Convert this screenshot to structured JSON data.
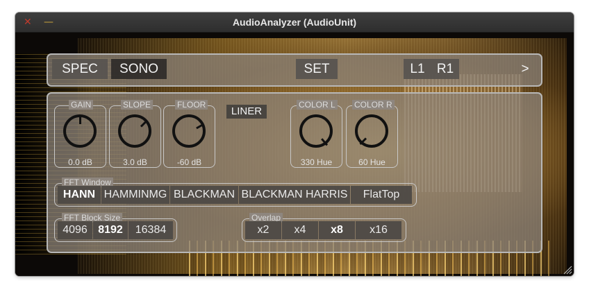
{
  "window": {
    "title": "AudioAnalyzer (AudioUnit)",
    "close_glyph": "✕",
    "minimize_glyph": "—"
  },
  "topbar": {
    "spec_label": "SPEC",
    "sono_label": "SONO",
    "set_label": "SET",
    "left_channel": "L1",
    "right_channel": "R1",
    "next_label": ">"
  },
  "knobs": [
    {
      "label": "GAIN",
      "value": "0.0 dB",
      "angle": 0
    },
    {
      "label": "SLOPE",
      "value": "3.0 dB",
      "angle": 45
    },
    {
      "label": "FLOOR",
      "value": "-60 dB",
      "angle": 60
    },
    {
      "label": "COLOR L",
      "value": "330 Hue",
      "angle": 140
    },
    {
      "label": "COLOR R",
      "value": "60 Hue",
      "angle": 225
    }
  ],
  "liner_label": "LINER",
  "fft_window": {
    "label": "FFT Window",
    "options": [
      "HANN",
      "HAMMINMG",
      "BLACKMAN",
      "BLACKMAN HARRIS",
      "FlatTop"
    ],
    "selected": "HANN"
  },
  "fft_block": {
    "label": "FFT Block Size",
    "options": [
      "4096",
      "8192",
      "16384"
    ],
    "selected": "8192"
  },
  "overlap": {
    "label": "Overlap",
    "options": [
      "x2",
      "x4",
      "x8",
      "x16"
    ],
    "selected": "x8"
  },
  "colors": {
    "panel_border": "#b8b8b8",
    "knob": "#111111",
    "titlebar": "#363636",
    "close": "#c03a2c",
    "minimize": "#c9a23b"
  }
}
